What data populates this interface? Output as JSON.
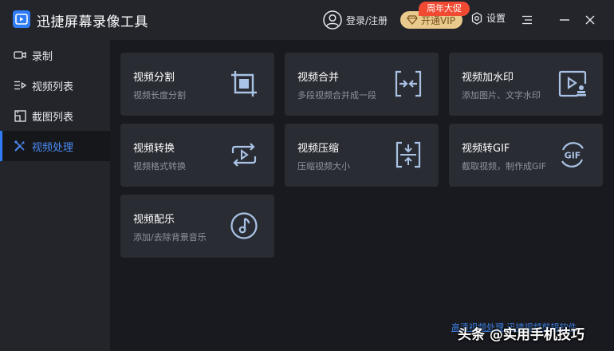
{
  "app": {
    "title": "迅捷屏幕录像工具",
    "login_label": "登录/注册",
    "vip_label": "开通VIP",
    "promo_badge": "周年大促",
    "settings_label": "设置"
  },
  "sidebar": {
    "items": [
      {
        "label": "录制",
        "icon": "video-camera-icon",
        "active": false
      },
      {
        "label": "视频列表",
        "icon": "video-list-icon",
        "active": false
      },
      {
        "label": "截图列表",
        "icon": "screenshot-list-icon",
        "active": false
      },
      {
        "label": "视频处理",
        "icon": "tools-icon",
        "active": true
      }
    ]
  },
  "cards": [
    {
      "title": "视频分割",
      "desc": "视频长度分割",
      "icon": "crop-icon"
    },
    {
      "title": "视频合并",
      "desc": "多段视频合并成一段",
      "icon": "merge-icon"
    },
    {
      "title": "视频加水印",
      "desc": "添加图片、文字水印",
      "icon": "watermark-icon"
    },
    {
      "title": "视频转换",
      "desc": "视频格式转换",
      "icon": "convert-icon"
    },
    {
      "title": "视频压缩",
      "desc": "压缩视频大小",
      "icon": "compress-icon"
    },
    {
      "title": "视频转GIF",
      "desc": "截取视频，制作成GIF",
      "icon": "gif-icon"
    },
    {
      "title": "视频配乐",
      "desc": "添加/去除背景音乐",
      "icon": "music-icon"
    }
  ],
  "gif_icon_text": "GIF",
  "footer": {
    "link_text": "高清视频处理 迅捷视频剪辑软件"
  },
  "watermark": "头条 @实用手机技巧",
  "colors": {
    "accent": "#2f7cf6",
    "active_text": "#4c8cf6",
    "vip_gold": "#e9c98c",
    "promo_red": "#f04a32",
    "card_bg": "#2a2c33",
    "icon_stroke": "#a9c3e6"
  }
}
